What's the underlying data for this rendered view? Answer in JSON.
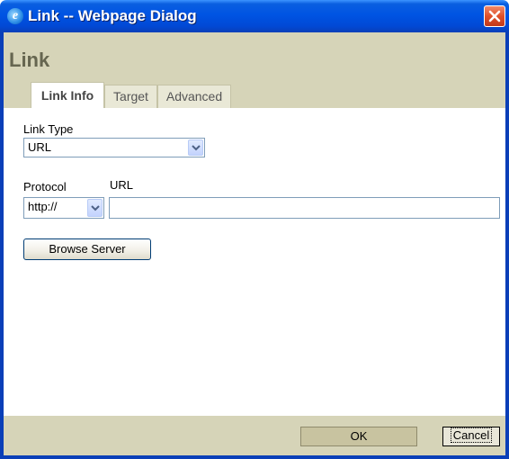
{
  "window": {
    "title": "Link -- Webpage Dialog",
    "icon": "ie-icon",
    "close_icon": "close-icon"
  },
  "dialog": {
    "heading": "Link",
    "tabs": [
      {
        "label": "Link Info",
        "active": true
      },
      {
        "label": "Target",
        "active": false
      },
      {
        "label": "Advanced",
        "active": false
      }
    ]
  },
  "form": {
    "link_type": {
      "label": "Link Type",
      "value": "URL"
    },
    "protocol": {
      "label": "Protocol",
      "value": "http://"
    },
    "url": {
      "label": "URL",
      "value": ""
    },
    "browse_button": "Browse Server"
  },
  "footer": {
    "ok_label": "OK",
    "cancel_label": "Cancel"
  },
  "colors": {
    "titlebar": "#0054e3",
    "panel": "#d6d4b8",
    "field_border": "#7f9db9"
  }
}
